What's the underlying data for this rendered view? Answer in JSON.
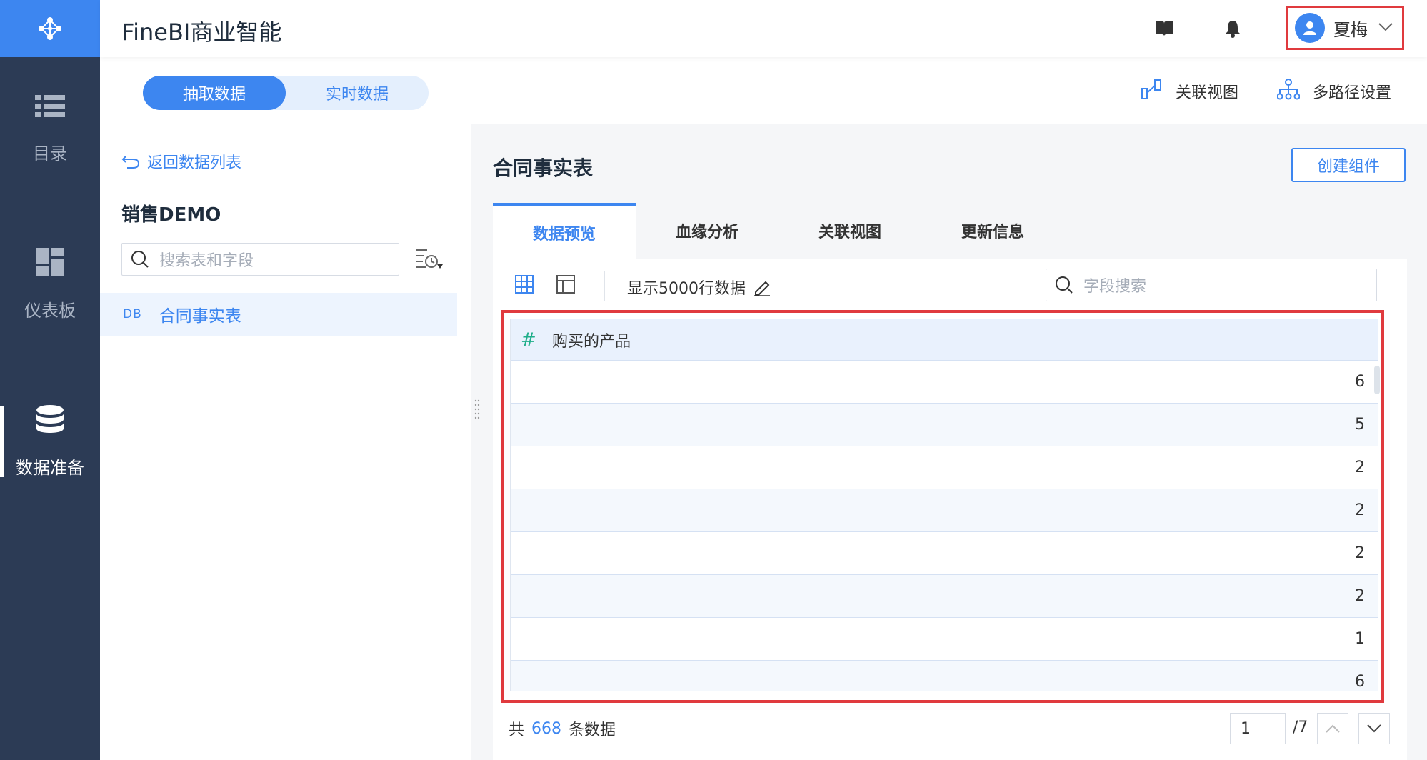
{
  "rail": {
    "items": [
      {
        "label": "目录",
        "icon": "list-icon"
      },
      {
        "label": "仪表板",
        "icon": "dashboard-icon"
      },
      {
        "label": "数据准备",
        "icon": "database-icon",
        "active": true
      }
    ]
  },
  "header": {
    "app_title": "FineBI商业智能",
    "user_name": "夏梅"
  },
  "mode": {
    "extract_label": "抽取数据",
    "realtime_label": "实时数据",
    "selected": "抽取数据"
  },
  "top_links": {
    "relation_view": "关联视图",
    "multipath": "多路径设置"
  },
  "left_panel": {
    "back_label": "返回数据列表",
    "package_title": "销售DEMO",
    "search_placeholder": "搜索表和字段",
    "table_item": {
      "type_tag": "DB",
      "label": "合同事实表"
    }
  },
  "main": {
    "table_title": "合同事实表",
    "create_button": "创建组件",
    "tabs": [
      "数据预览",
      "血缘分析",
      "关联视图",
      "更新信息"
    ],
    "active_tab": "数据预览",
    "rows_label": "显示5000行数据",
    "field_search_placeholder": "字段搜索",
    "grid": {
      "column": "购买的产品",
      "rows": [
        "6",
        "5",
        "2",
        "2",
        "2",
        "2",
        "1",
        "6"
      ]
    },
    "footer": {
      "total_prefix": "共",
      "total_count": "668",
      "total_suffix": "条数据",
      "page": "1",
      "page_total": "/7"
    }
  },
  "colors": {
    "accent": "#3d86f0",
    "rail": "#2c3b55",
    "highlight": "#e03a3e"
  }
}
